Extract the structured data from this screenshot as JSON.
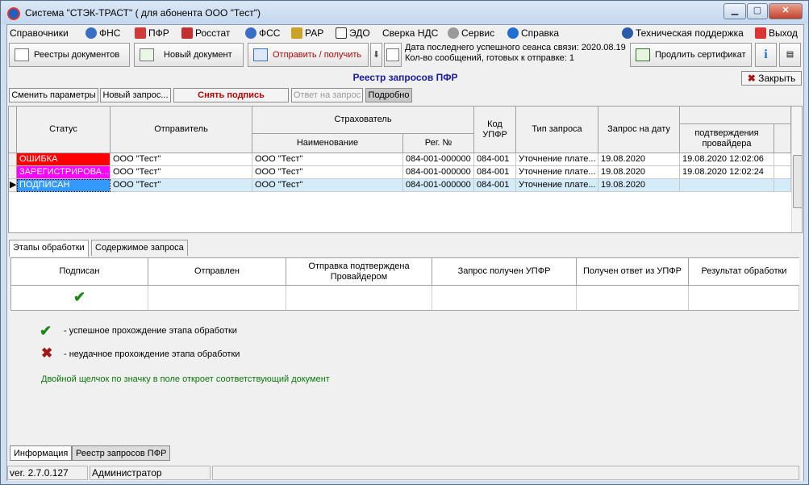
{
  "window": {
    "title": "Система \"СТЭК-ТРАСТ\" ( для абонента ООО \"Тест\")"
  },
  "menu": [
    {
      "label": "Справочники",
      "icon": "none"
    },
    {
      "label": "ФНС",
      "icon": "fns-icon"
    },
    {
      "label": "ПФР",
      "icon": "pfr-icon"
    },
    {
      "label": "Росстат",
      "icon": "rosstat-icon"
    },
    {
      "label": "ФСС",
      "icon": "fss-icon"
    },
    {
      "label": "РАР",
      "icon": "rar-icon"
    },
    {
      "label": "ЭДО",
      "icon": "edo-icon"
    },
    {
      "label": "Сверка НДС",
      "icon": "none"
    },
    {
      "label": "Сервис",
      "icon": "gear-icon"
    },
    {
      "label": "Справка",
      "icon": "help-icon"
    }
  ],
  "menu_right": {
    "support": "Техническая поддержка",
    "exit": "Выход"
  },
  "toolbar": {
    "registries": "Реестры документов",
    "new_doc": "Новый документ",
    "send_receive": "Отправить / получить",
    "info_line1": "Дата последнего успешного сеанса связи: 2020.08.19",
    "info_line2": "Кол-во сообщений, готовых к отправке: 1",
    "renew_cert": "Продлить сертификат"
  },
  "panel": {
    "title": "Реестр запросов ПФР",
    "close": "Закрыть"
  },
  "actions": {
    "change_params": "Сменить параметры",
    "new_request": "Новый запрос...",
    "remove_sign": "Снять подпись",
    "reply": "Ответ на запрос",
    "details": "Подробно"
  },
  "grid": {
    "headers": {
      "status": "Статус",
      "sender": "Отправитель",
      "insurer": "Страхователь",
      "name": "Наименование",
      "reg": "Рег. №",
      "code": "Код УПФР",
      "type": "Тип запроса",
      "date": "Запрос на дату",
      "confirm": "подтверждения провайдера"
    },
    "rows": [
      {
        "status": "ОШИБКА",
        "status_color": "#ff0000",
        "sender": "ООО \"Тест\"",
        "name": "ООО \"Тест\"",
        "reg": "084-001-000000",
        "code": "084-001",
        "type": "Уточнение плате...",
        "date": "19.08.2020",
        "confirm": "19.08.2020 12:02:06"
      },
      {
        "status": "ЗАРЕГИСТРИРОВА...",
        "status_color": "#ff00ff",
        "sender": "ООО \"Тест\"",
        "name": "ООО \"Тест\"",
        "reg": "084-001-000000",
        "code": "084-001",
        "type": "Уточнение плате...",
        "date": "19.08.2020",
        "confirm": "19.08.2020 12:02:24"
      },
      {
        "status": "ПОДПИСАН",
        "status_color": "#3399ff",
        "sender": "ООО \"Тест\"",
        "name": "ООО \"Тест\"",
        "reg": "084-001-000000",
        "code": "084-001",
        "type": "Уточнение плате...",
        "date": "19.08.2020",
        "confirm": ""
      }
    ]
  },
  "tabs": [
    "Этапы обработки",
    "Содержимое запроса"
  ],
  "stages": {
    "headers": [
      "Подписан",
      "Отправлен",
      "Отправка подтверждена Провайдером",
      "Запрос получен УПФР",
      "Получен ответ из УПФР",
      "Результат обработки"
    ],
    "values": [
      "check",
      "",
      "",
      "",
      "",
      ""
    ]
  },
  "legend": {
    "success": "-  успешное прохождение этапа обработки",
    "fail": "-  неудачное прохождение этапа обработки",
    "hint": "Двойной щелчок по значку в поле откроет соответствующий документ"
  },
  "bottom_tabs": [
    "Информация",
    "Реестр запросов ПФР"
  ],
  "status": {
    "version": "ver. 2.7.0.127",
    "user": "Администратор"
  },
  "colors": {
    "accent_title": "#1a1aa8",
    "success_check": "#1a8a1a",
    "fail_cross": "#a01818",
    "hint_text": "#0a7a0a",
    "selected_row": "#d4ecf8"
  }
}
